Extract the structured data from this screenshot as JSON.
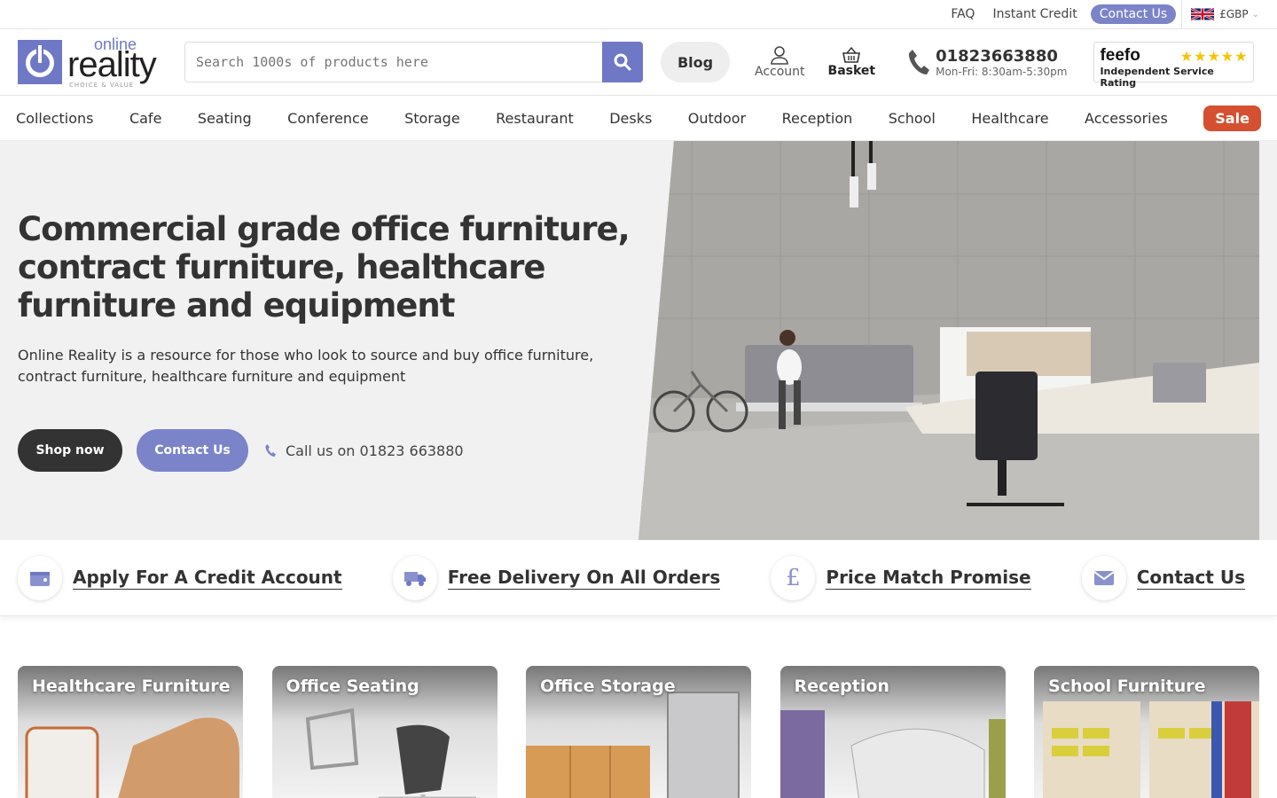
{
  "topbar": {
    "faq": "FAQ",
    "instant_credit": "Instant Credit",
    "contact": "Contact Us",
    "currency": "£GBP"
  },
  "header": {
    "logo_top": "online",
    "logo_main": "reality",
    "logo_tag": "CHOICE & VALUE",
    "search_placeholder": "Search 1000s of products here",
    "blog": "Blog",
    "account": "Account",
    "basket": "Basket",
    "phone": "01823663880",
    "hours": "Mon-Fri: 8:30am-5:30pm",
    "feefo_brand": "feefo",
    "feefo_rating": "Independent Service Rating",
    "feefo_stars": "★★★★★"
  },
  "nav": {
    "items": [
      "Collections",
      "Cafe",
      "Seating",
      "Conference",
      "Storage",
      "Restaurant",
      "Desks",
      "Outdoor",
      "Reception",
      "School",
      "Healthcare",
      "Accessories"
    ],
    "sale": "Sale"
  },
  "hero": {
    "title": "Commercial grade office furniture, contract furniture, healthcare furniture and equipment",
    "subtitle": "Online Reality is a resource for those who look to source and buy office furniture, contract furniture, healthcare furniture and equipment",
    "shop_now": "Shop now",
    "contact": "Contact Us",
    "call": "Call us on 01823 663880"
  },
  "usps": [
    {
      "label": "Apply For A Credit Account",
      "icon": "wallet-icon"
    },
    {
      "label": "Free Delivery On All Orders",
      "icon": "truck-icon"
    },
    {
      "label": "Price Match Promise",
      "icon": "pound-icon"
    },
    {
      "label": "Contact Us",
      "icon": "envelope-icon"
    }
  ],
  "categories": [
    "Healthcare Furniture",
    "Office Seating",
    "Office Storage",
    "Reception",
    "School Furniture"
  ],
  "colors": {
    "brand": "#7b83c9",
    "sale": "#d45030",
    "dark": "#333333"
  }
}
